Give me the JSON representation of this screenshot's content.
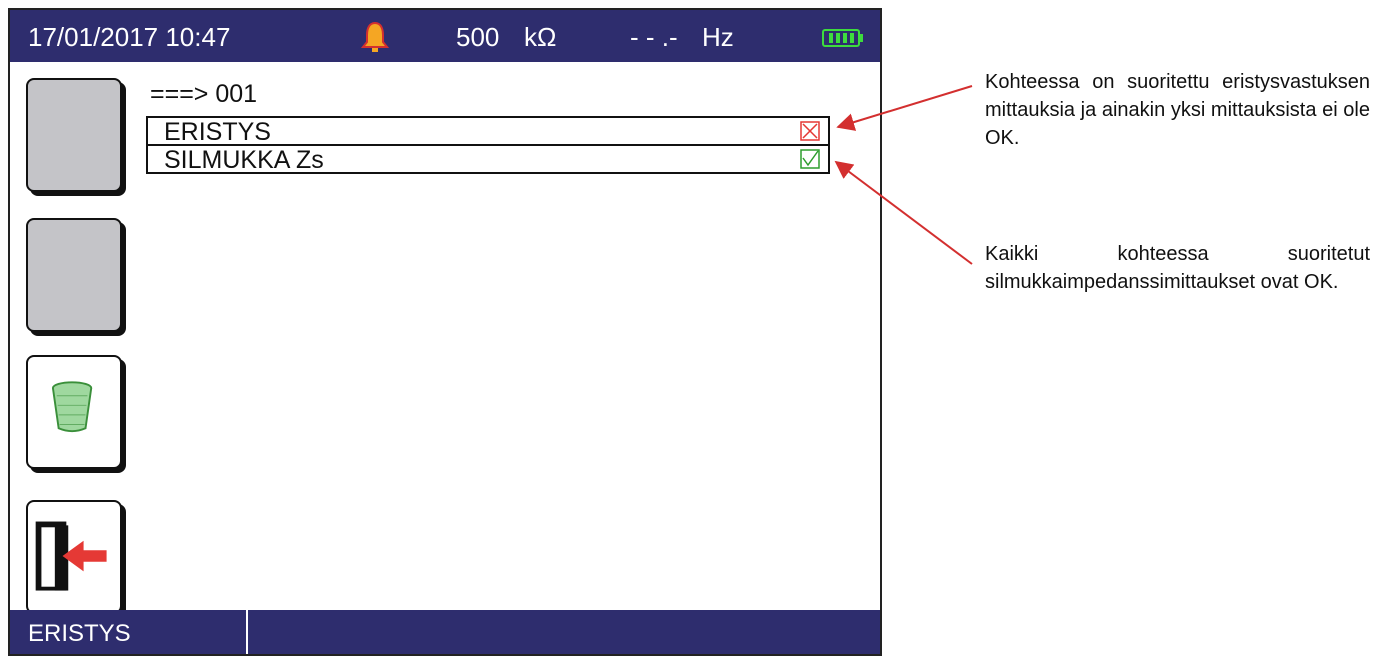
{
  "status": {
    "datetime": "17/01/2017 10:47",
    "voltage_value": "500",
    "voltage_unit": "kΩ",
    "frequency_value": "- - .-",
    "frequency_unit": "Hz",
    "alarm_icon": "bell-icon",
    "battery_icon": "battery-full-icon"
  },
  "main": {
    "path_label": "===> 001",
    "items": [
      {
        "label": "ERISTYS",
        "status": "fail"
      },
      {
        "label": "SILMUKKA Zs",
        "status": "ok"
      }
    ]
  },
  "side_buttons": [
    {
      "icon": ""
    },
    {
      "icon": ""
    },
    {
      "icon": "trash-icon"
    },
    {
      "icon": "exit-door-icon"
    }
  ],
  "bottom": {
    "active_tab": "ERISTYS"
  },
  "annotations": [
    {
      "text": "Kohteessa on suoritettu eristysvastuksen mittauksia ja ainakin yksi mittauksista ei ole OK."
    },
    {
      "text": "Kaikki kohteessa suoritetut silmukkaimpedanssimittaukset ovat OK."
    }
  ],
  "colors": {
    "bar": "#2e2d6e",
    "fail": "#e53935",
    "ok": "#2e9e2e",
    "arrow": "#d32f2f"
  }
}
